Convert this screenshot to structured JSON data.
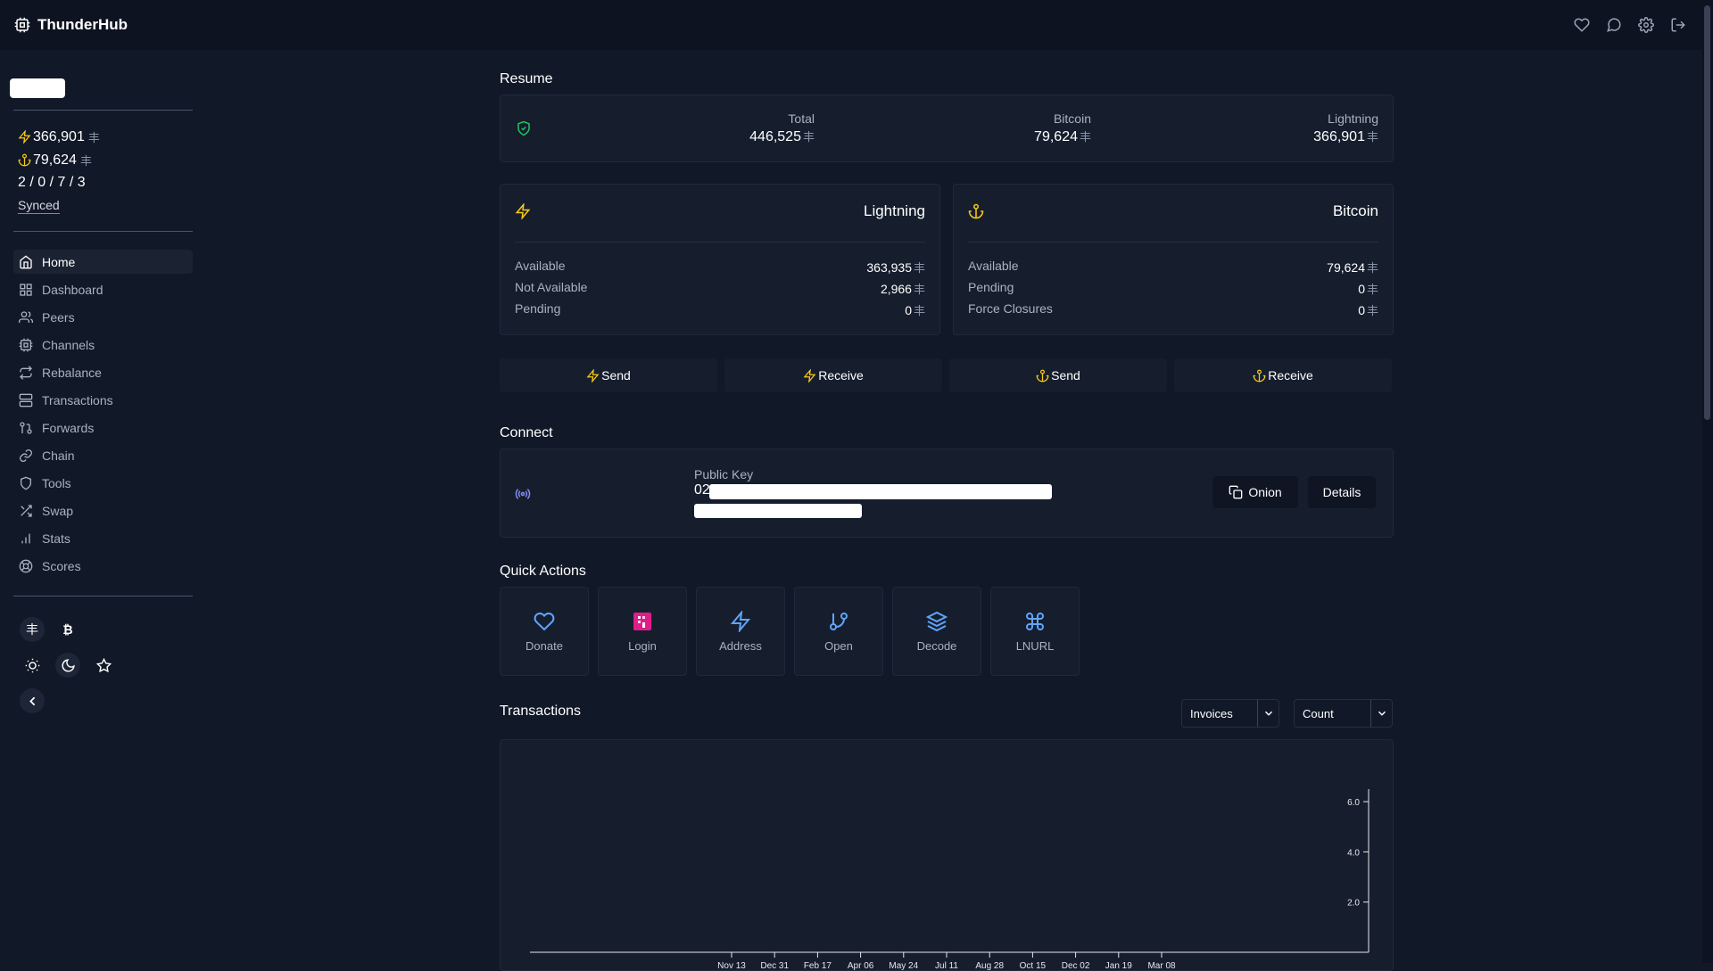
{
  "app": {
    "title": "ThunderHub"
  },
  "colors": {
    "accent_yellow": "#facc15",
    "accent_blue": "#60a5fa",
    "synced_green": "#22c55e",
    "login_pink": "#e11d8a"
  },
  "sidebar": {
    "lightning_balance": "366,901",
    "bitcoin_balance": "79,624",
    "channel_counts": "2 / 0 / 7 / 3",
    "sync_status": "Synced",
    "nav": [
      {
        "label": "Home",
        "icon": "home-icon"
      },
      {
        "label": "Dashboard",
        "icon": "grid-icon"
      },
      {
        "label": "Peers",
        "icon": "users-icon"
      },
      {
        "label": "Channels",
        "icon": "cpu-icon"
      },
      {
        "label": "Rebalance",
        "icon": "repeat-icon"
      },
      {
        "label": "Transactions",
        "icon": "server-icon"
      },
      {
        "label": "Forwards",
        "icon": "git-pull-request-icon"
      },
      {
        "label": "Chain",
        "icon": "link-icon"
      },
      {
        "label": "Tools",
        "icon": "shield-icon"
      },
      {
        "label": "Swap",
        "icon": "shuffle-icon"
      },
      {
        "label": "Stats",
        "icon": "bar-chart-icon"
      },
      {
        "label": "Scores",
        "icon": "life-buoy-icon"
      }
    ],
    "currency_btc_symbol": "₿"
  },
  "unit_symbol": "丰",
  "resume": {
    "title": "Resume",
    "total_label": "Total",
    "total_value": "446,525",
    "bitcoin_label": "Bitcoin",
    "bitcoin_value": "79,624",
    "lightning_label": "Lightning",
    "lightning_value": "366,901"
  },
  "lightning_card": {
    "title": "Lightning",
    "rows": [
      {
        "label": "Available",
        "value": "363,935"
      },
      {
        "label": "Not Available",
        "value": "2,966"
      },
      {
        "label": "Pending",
        "value": "0"
      }
    ]
  },
  "bitcoin_card": {
    "title": "Bitcoin",
    "rows": [
      {
        "label": "Available",
        "value": "79,624"
      },
      {
        "label": "Pending",
        "value": "0"
      },
      {
        "label": "Force Closures",
        "value": "0"
      }
    ]
  },
  "actions": {
    "send": "Send",
    "receive": "Receive"
  },
  "connect": {
    "title": "Connect",
    "public_key_label": "Public Key",
    "public_key_prefix": "02",
    "onion_button": "Onion",
    "details_button": "Details"
  },
  "quick_actions": {
    "title": "Quick Actions",
    "items": [
      "Donate",
      "Login",
      "Address",
      "Open",
      "Decode",
      "LNURL"
    ]
  },
  "transactions": {
    "title": "Transactions",
    "type_select": "Invoices",
    "metric_select": "Count"
  },
  "chart_data": {
    "type": "bar",
    "title": "",
    "xlabel": "",
    "ylabel": "",
    "x_ticks": [
      "Nov 13",
      "Dec 31",
      "Feb 17",
      "Apr 06",
      "May 24",
      "Jul 11",
      "Aug 28",
      "Oct 15",
      "Dec 02",
      "Jan 19",
      "Mar 08"
    ],
    "y_ticks": [
      "2.0",
      "4.0",
      "6.0"
    ],
    "ylim": [
      0,
      6.5
    ],
    "values": [],
    "grid": false
  }
}
